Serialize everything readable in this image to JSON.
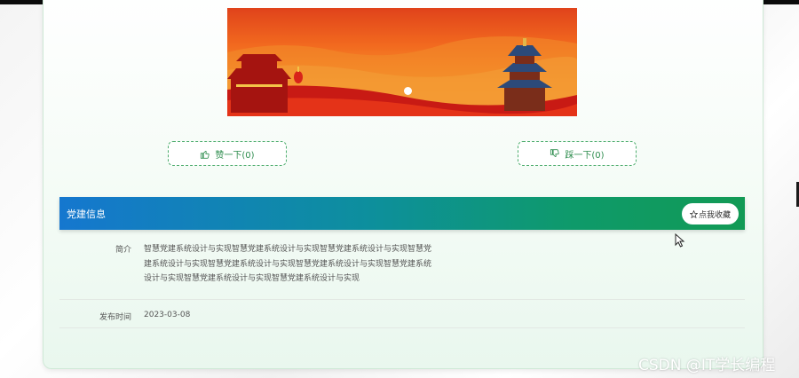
{
  "banner": {
    "carousel_indicator": "active"
  },
  "votes": {
    "like_label": "赞一下(0)",
    "dislike_label": "踩一下(0)"
  },
  "section": {
    "title": "党建信息",
    "favorite_label": "点我收藏"
  },
  "details": {
    "intro_label": "简介",
    "intro_text": "智慧党建系统设计与实现智慧党建系统设计与实现智慧党建系统设计与实现智慧党建系统设计与实现智慧党建系统设计与实现智慧党建系统设计与实现智慧党建系统设计与实现智慧党建系统设计与实现智慧党建系统设计与实现",
    "date_label": "发布时间",
    "date_value": "2023-03-08"
  },
  "watermark": "CSDN @IT学长编程",
  "colors": {
    "header_start": "#1577cf",
    "header_end": "#129a55",
    "accent_green": "#2e8d4e"
  }
}
